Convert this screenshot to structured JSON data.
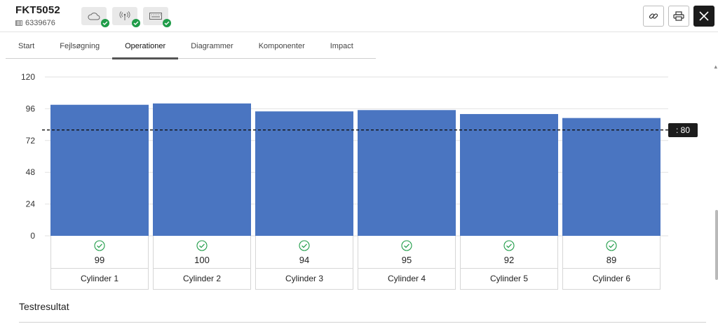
{
  "header": {
    "title": "FKT5052",
    "subtitle": "6339676",
    "status_icons": [
      "cloud-icon",
      "antenna-icon",
      "keyboard-icon"
    ],
    "actions": [
      "link-icon",
      "print-icon",
      "close-icon"
    ]
  },
  "tabs": [
    {
      "label": "Start",
      "active": false
    },
    {
      "label": "Fejlsøgning",
      "active": false
    },
    {
      "label": "Operationer",
      "active": true
    },
    {
      "label": "Diagrammer",
      "active": false
    },
    {
      "label": "Komponenter",
      "active": false
    },
    {
      "label": "Impact",
      "active": false
    }
  ],
  "chart_data": {
    "type": "bar",
    "categories": [
      "Cylinder 1",
      "Cylinder 2",
      "Cylinder 3",
      "Cylinder 4",
      "Cylinder 5",
      "Cylinder 6"
    ],
    "values": [
      99,
      100,
      94,
      95,
      92,
      89
    ],
    "ylim": [
      0,
      120
    ],
    "yticks": [
      0,
      24,
      48,
      72,
      96,
      120
    ],
    "threshold": 80,
    "threshold_label": ": 80",
    "bar_color": "#4a75c1",
    "grid": true,
    "status": [
      "ok",
      "ok",
      "ok",
      "ok",
      "ok",
      "ok"
    ]
  },
  "section": {
    "title": "Testresultat"
  },
  "colors": {
    "ok_green": "#1f9c48",
    "accent_dark": "#1b1b1b"
  }
}
